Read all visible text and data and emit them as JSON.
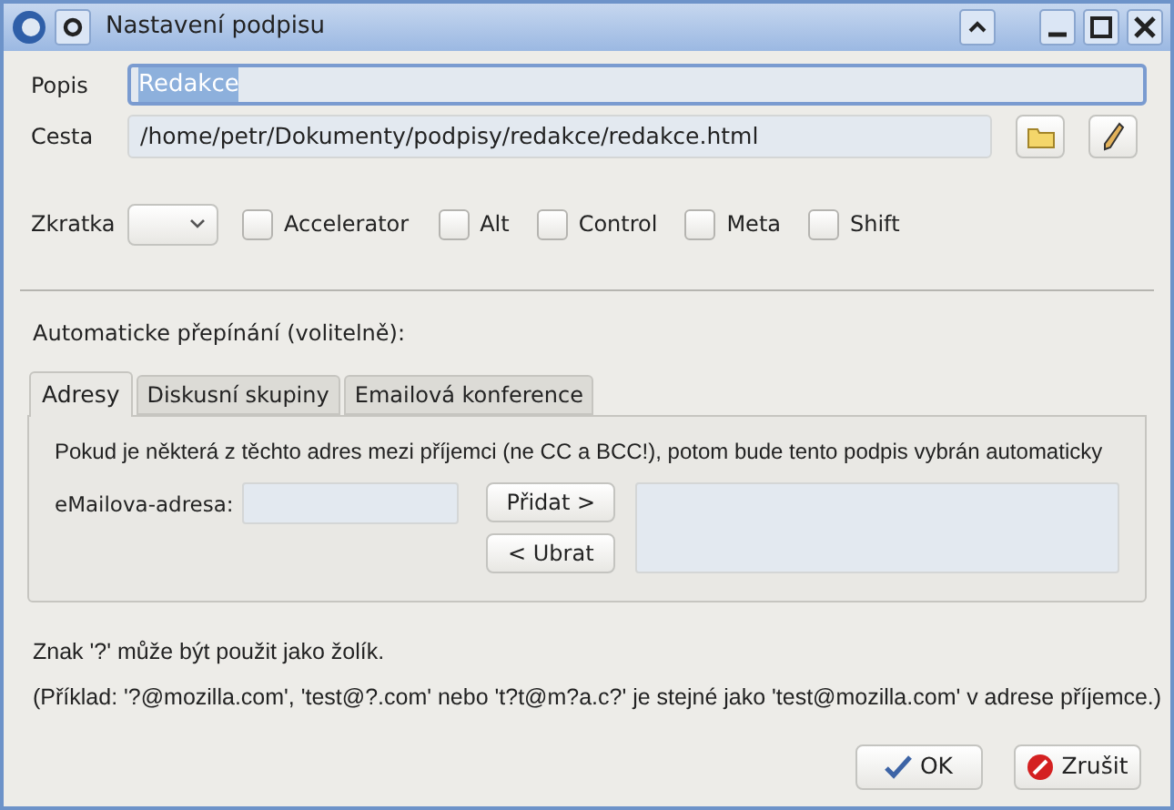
{
  "window": {
    "title": "Nastavení podpisu"
  },
  "description": {
    "label": "Popis",
    "value": "Redakce",
    "focused": true
  },
  "path": {
    "label": "Cesta",
    "value": "/home/petr/Dokumenty/podpisy/redakce/redakce.html"
  },
  "shortcut": {
    "label": "Zkratka",
    "modifiers": [
      {
        "label": "Accelerator",
        "checked": false
      },
      {
        "label": "Alt",
        "checked": false
      },
      {
        "label": "Control",
        "checked": false
      },
      {
        "label": "Meta",
        "checked": false
      },
      {
        "label": "Shift",
        "checked": false
      }
    ]
  },
  "auto_switch": {
    "label": "Automaticke přepínání (volitelně):",
    "tabs": [
      {
        "label": "Adresy",
        "selected": true
      },
      {
        "label": "Diskusní skupiny",
        "selected": false
      },
      {
        "label": "Emailová konference",
        "selected": false
      }
    ],
    "panel": {
      "hint": "Pokud je některá z těchto adres mezi příjemci (ne CC a BCC!), potom bude tento podpis vybrán automaticky",
      "email_label": "eMailova-adresa:",
      "add_button": "Přidat >",
      "remove_button": "< Ubrat"
    }
  },
  "notes": [
    "Znak '?' může být použit jako žolík.",
    "(Příklad: '?@mozilla.com', 'test@?.com' nebo 't?t@m?a.c?' je stejné jako 'test@mozilla.com' v adrese příjemce.)"
  ],
  "buttons": [
    {
      "kind": "ok",
      "label": "OK"
    },
    {
      "kind": "cancel",
      "label": "Zrušit"
    }
  ]
}
